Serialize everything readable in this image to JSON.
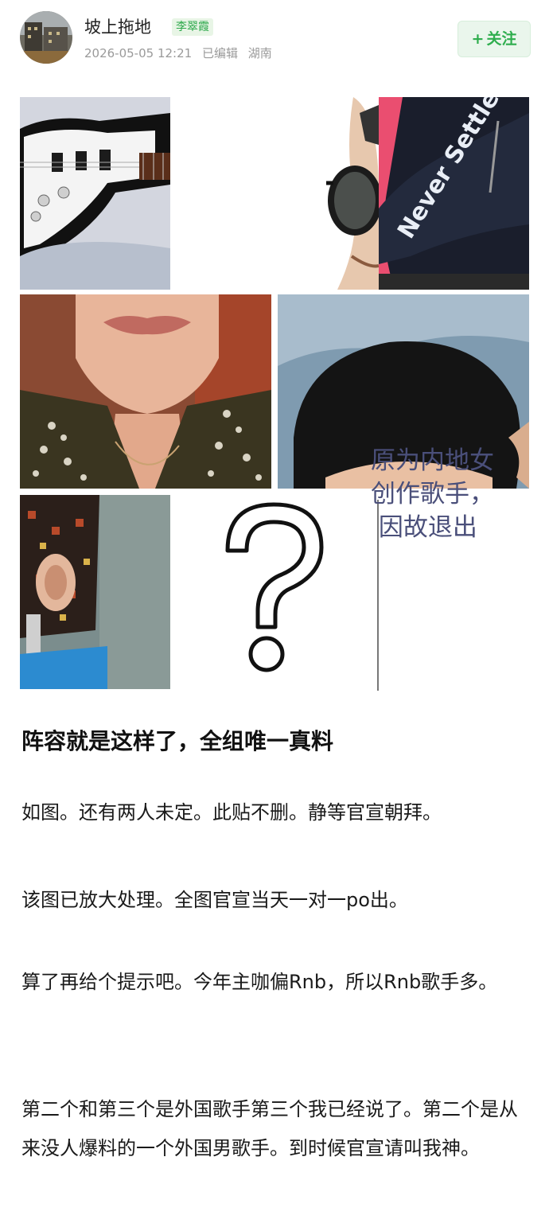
{
  "post": {
    "author": "坡上拖地",
    "author_tag": "李翠霞",
    "date": "2026-05-05 12:21",
    "edited": "已编辑",
    "location": "湖南",
    "follow_label": "关注",
    "follow_icon": "plus-icon"
  },
  "collage": {
    "overlay_text": "原为内地女\n创作歌手，\n 因故退出",
    "jacket_text": "Never Settle",
    "question_mark": "?"
  },
  "content": {
    "headline": "阵容就是这样了，全组唯一真料",
    "paragraphs": [
      "如图。还有两人未定。此贴不删。静等官宣朝拜。",
      "该图已放大处理。全图官宣当天一对一po出。",
      "算了再给个提示吧。今年主咖偏Rnb，所以Rnb歌手多。",
      "第二个和第三个是外国歌手第三个我已经说了。第二个是从来没人爆料的一个外国男歌手。到时候官宣请叫我神。"
    ]
  },
  "colors": {
    "accent": "#2fae4e",
    "tag_bg": "#e8f5e6",
    "overlay_text": "#4a4f7a"
  }
}
